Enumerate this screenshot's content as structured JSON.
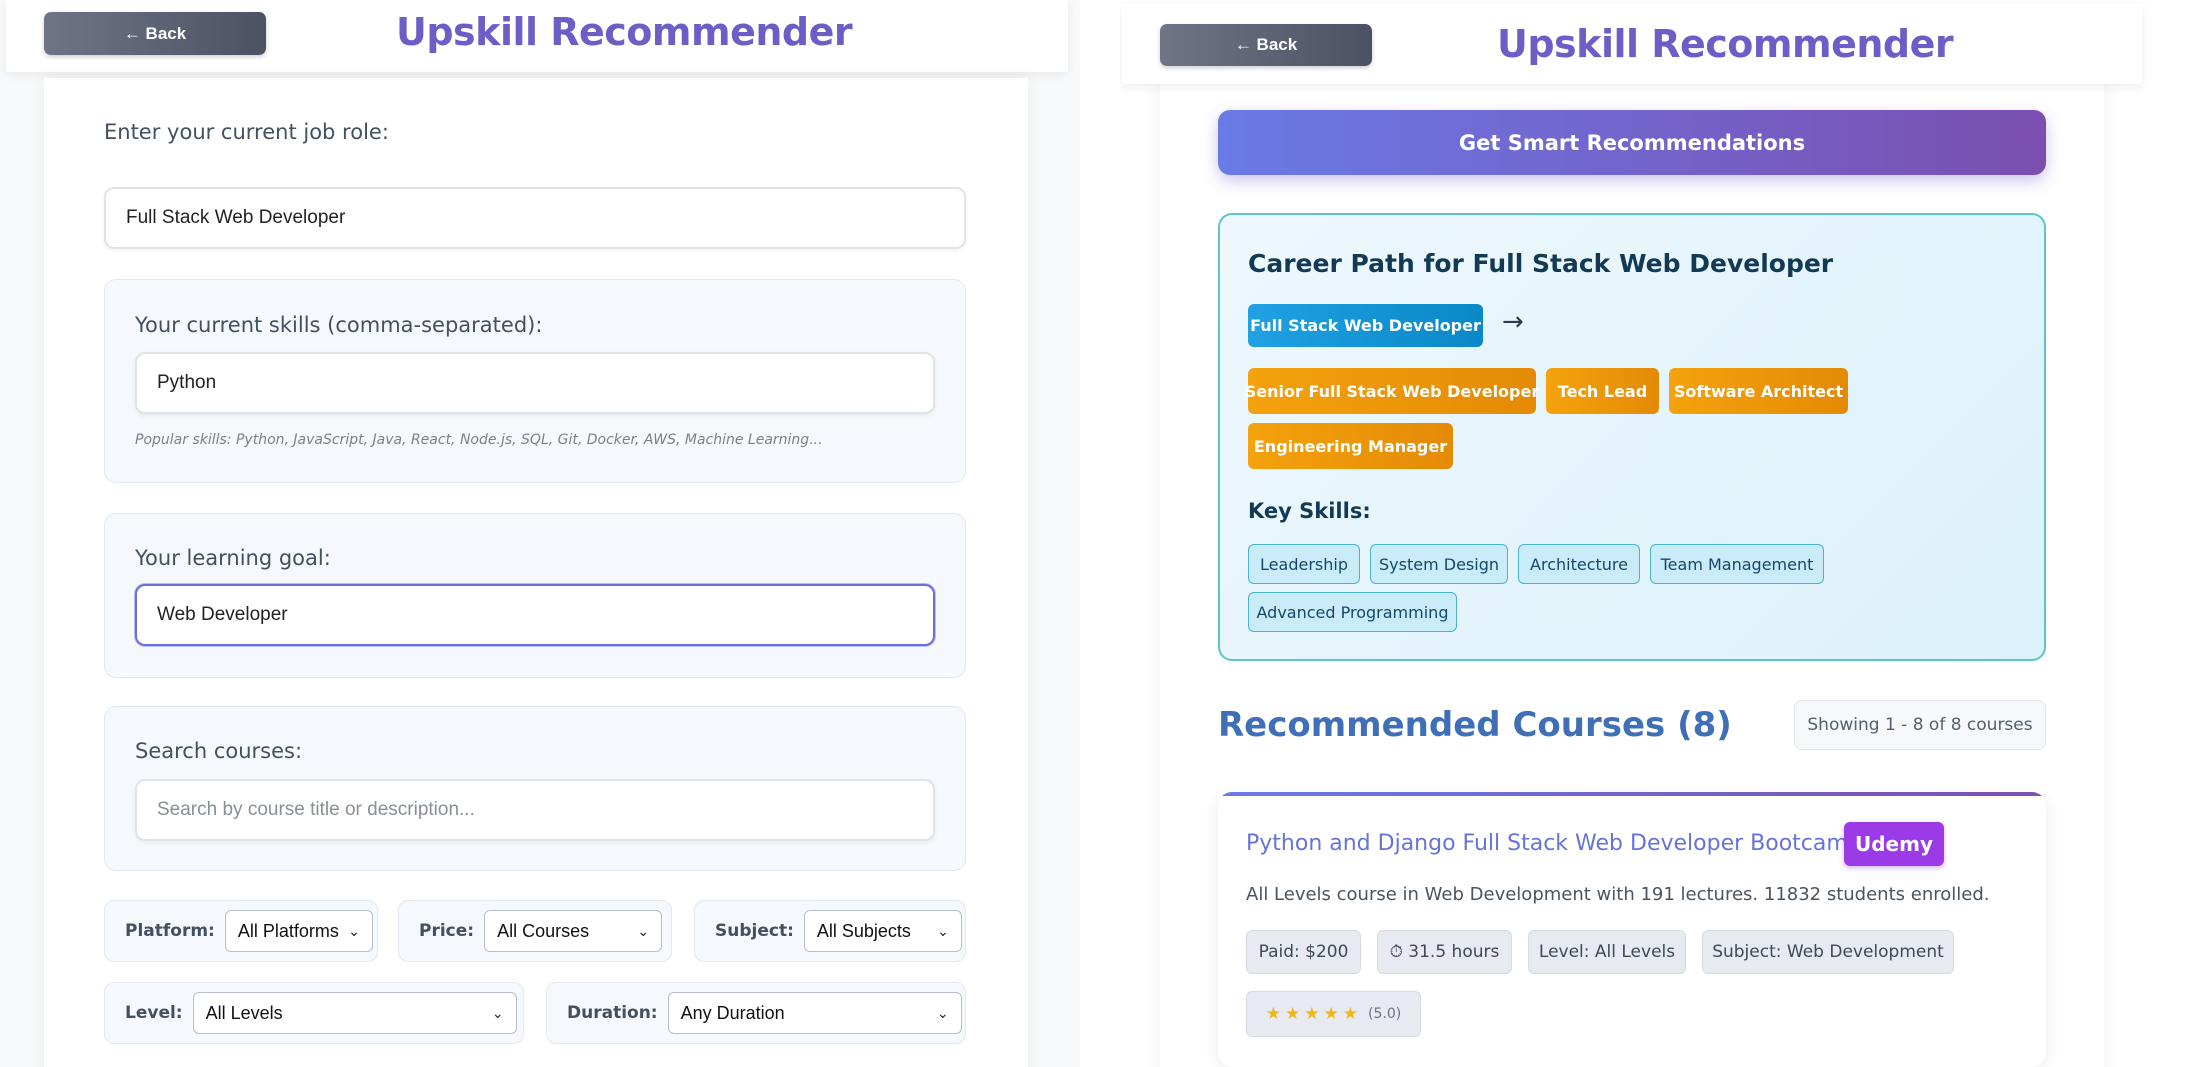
{
  "left": {
    "header": {
      "back_label": "← Back",
      "title": "Upskill Recommender"
    },
    "job_role": {
      "label": "Enter your current job role:",
      "value": "Full Stack Web Developer"
    },
    "skills": {
      "label": "Your current skills (comma-separated):",
      "value": "Python",
      "hint": "Popular skills: Python, JavaScript, Java, React, Node.js, SQL, Git, Docker, AWS, Machine Learning..."
    },
    "goal": {
      "label": "Your learning goal:",
      "value": "Web Developer"
    },
    "search": {
      "label": "Search courses:",
      "placeholder": "Search by course title or description..."
    },
    "filters": {
      "platform": {
        "label": "Platform:",
        "value": "All Platforms"
      },
      "price": {
        "label": "Price:",
        "value": "All Courses"
      },
      "subject": {
        "label": "Subject:",
        "value": "All Subjects"
      },
      "level": {
        "label": "Level:",
        "value": "All Levels"
      },
      "duration": {
        "label": "Duration:",
        "value": "Any Duration"
      }
    }
  },
  "right": {
    "header": {
      "back_label": "← Back",
      "title": "Upskill Recommender"
    },
    "recommend_button": "Get Smart Recommendations",
    "career": {
      "title": "Career Path for Full Stack Web Developer",
      "current": "Full Stack Web Developer",
      "arrow": "→",
      "next_roles": [
        "Senior Full Stack Web Developer",
        "Tech Lead",
        "Software Architect",
        "Engineering Manager"
      ],
      "key_skills_label": "Key Skills:",
      "key_skills": [
        "Leadership",
        "System Design",
        "Architecture",
        "Team Management",
        "Advanced Programming"
      ]
    },
    "courses": {
      "heading": "Recommended Courses (8)",
      "showing": "Showing 1 - 8 of 8 courses",
      "items": [
        {
          "title": "Python and Django Full Stack Web Developer Bootcamp",
          "platform": "Udemy",
          "description": "All Levels course in Web Development with 191 lectures. 11832 students enrolled.",
          "price": "Paid: $200",
          "duration": "⏱ 31.5 hours",
          "level": "Level: All Levels",
          "subject": "Subject: Web Development",
          "stars": "★★★★★",
          "rating": "(5.0)"
        }
      ]
    }
  },
  "colors": {
    "brand_title": "#6b5fc7",
    "primary_gradient_start": "#6a7ae6",
    "primary_gradient_end": "#7b4fb0",
    "career_chip_current": "#0a88c7",
    "career_chip_next": "#f4a20d",
    "platform_badge": "#9b3be8"
  }
}
